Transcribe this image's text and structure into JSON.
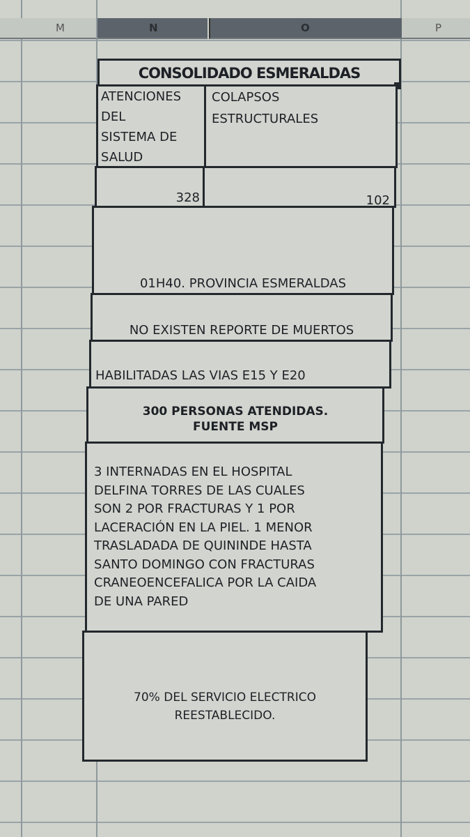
{
  "columns": [
    "M",
    "N",
    "O",
    "P"
  ],
  "title": "CONSOLIDADO ESMERALDAS",
  "headers": {
    "n": [
      "ATENCIONES",
      "DEL",
      "SISTEMA DE",
      "SALUD"
    ],
    "o": [
      "COLAPSOS",
      "ESTRUCTURALES"
    ]
  },
  "values": {
    "n": "328",
    "o": "102"
  },
  "rows": {
    "time_place": "01H40. PROVINCIA ESMERALDAS",
    "deaths": "NO EXISTEN REPORTE DE MUERTOS",
    "roads": "HABILITADAS LAS VIAS E15 Y E20",
    "attended": [
      "300 PERSONAS ATENDIDAS.",
      "FUENTE MSP"
    ],
    "detail": [
      "3 INTERNADAS EN EL HOSPITAL",
      "DELFINA TORRES DE LAS CUALES",
      "SON 2 POR FRACTURAS Y 1 POR",
      "LACERACIÓN EN LA PIEL. 1 MENOR",
      "TRASLADADA DE QUININDE HASTA",
      "SANTO DOMINGO CON FRACTURAS",
      "CRANEOENCEFALICA POR LA CAIDA",
      "DE UNA PARED"
    ],
    "power": [
      "70% DEL SERVICIO ELECTRICO",
      "REESTABLECIDO."
    ]
  }
}
